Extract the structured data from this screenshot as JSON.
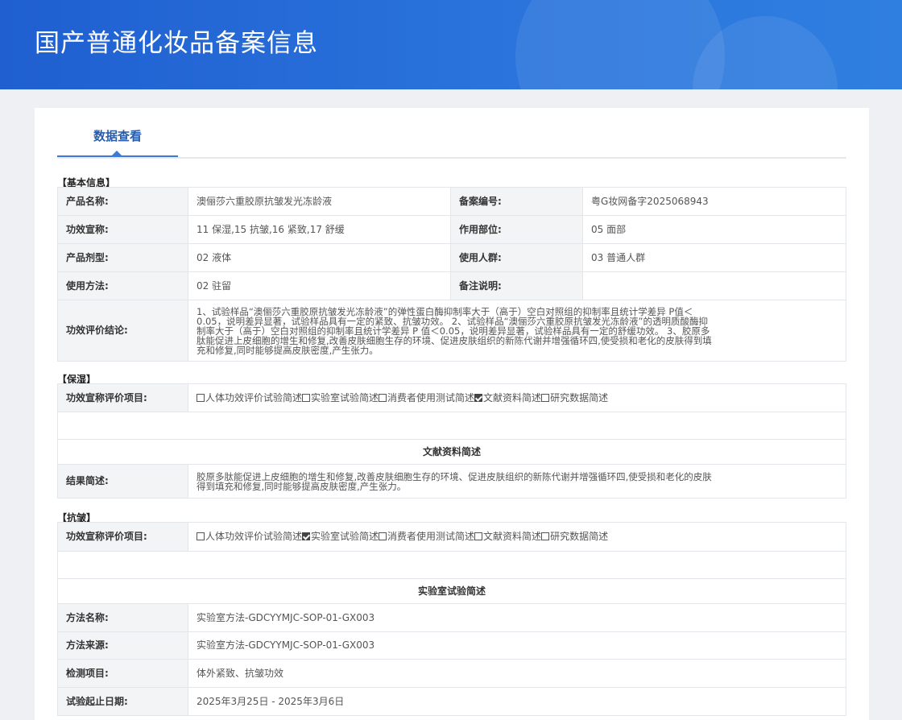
{
  "header": {
    "title": "国产普通化妆品备案信息"
  },
  "tabs": [
    {
      "label": "数据查看"
    }
  ],
  "basic": {
    "section_label": "【基本信息】",
    "product_name_label": "产品名称:",
    "product_name": "澳俪莎六重胶原抗皱发光冻龄液",
    "record_no_label": "备案编号:",
    "record_no": "粤G妆网备字2025068943",
    "efficacy_label": "功效宣称:",
    "efficacy": "11 保湿,15 抗皱,16 紧致,17 舒缓",
    "site_label": "作用部位:",
    "site": "05 面部",
    "form_label": "产品剂型:",
    "form": "02 液体",
    "users_label": "使用人群:",
    "users": "03 普通人群",
    "usage_label": "使用方法:",
    "usage": "02 驻留",
    "remark_label": "备注说明:",
    "remark": "",
    "conclusion_label": "功效评价结论:",
    "conclusion": "1、试验样品“澳俪莎六重胶原抗皱发光冻龄液”的弹性蛋白酶抑制率大于（高于）空白对照组的抑制率且统计学差异 P值＜0.05，说明差异显著，试验样品具有一定的紧致、抗皱功效。 2、试验样品“澳俪莎六重胶原抗皱发光冻龄液”的透明质酸酶抑制率大于（高于）空白对照组的抑制率且统计学差异 P 值＜0.05，说明差异显著，试验样品具有一定的舒缓功效。 3、胶原多肽能促进上皮细胞的增生和修复,改善皮肤细胞生存的环境、促进皮肤组织的新陈代谢并增强循环四,使受损和老化的皮肤得到填充和修复,同时能够提高皮肤密度,产生张力。"
  },
  "evaluation_options": [
    "人体功效评价试验简述",
    "实验室试验简述",
    "消费者使用测试简述",
    "文献资料简述",
    "研究数据简述"
  ],
  "moisturizing": {
    "section_label": "【保湿】",
    "items_label": "功效宣称评价项目:",
    "checked": [
      false,
      false,
      false,
      true,
      false
    ],
    "subsection_title": "文献资料简述",
    "result_label": "结果简述:",
    "result": "胶原多肽能促进上皮细胞的增生和修复,改善皮肤细胞生存的环境、促进皮肤组织的新陈代谢并增强循环四,使受损和老化的皮肤得到填充和修复,同时能够提高皮肤密度,产生张力。"
  },
  "antiwrinkle": {
    "section_label": "【抗皱】",
    "items_label": "功效宣称评价项目:",
    "checked": [
      false,
      true,
      false,
      false,
      false
    ],
    "subsection_title": "实验室试验简述",
    "method_name_label": "方法名称:",
    "method_name": "实验室方法-GDCYYMJC-SOP-01-GX003",
    "method_source_label": "方法来源:",
    "method_source": "实验室方法-GDCYYMJC-SOP-01-GX003",
    "test_item_label": "检测项目:",
    "test_item": "体外紧致、抗皱功效",
    "date_label": "试验起止日期:",
    "date": "2025年3月25日 - 2025年3月6日"
  }
}
